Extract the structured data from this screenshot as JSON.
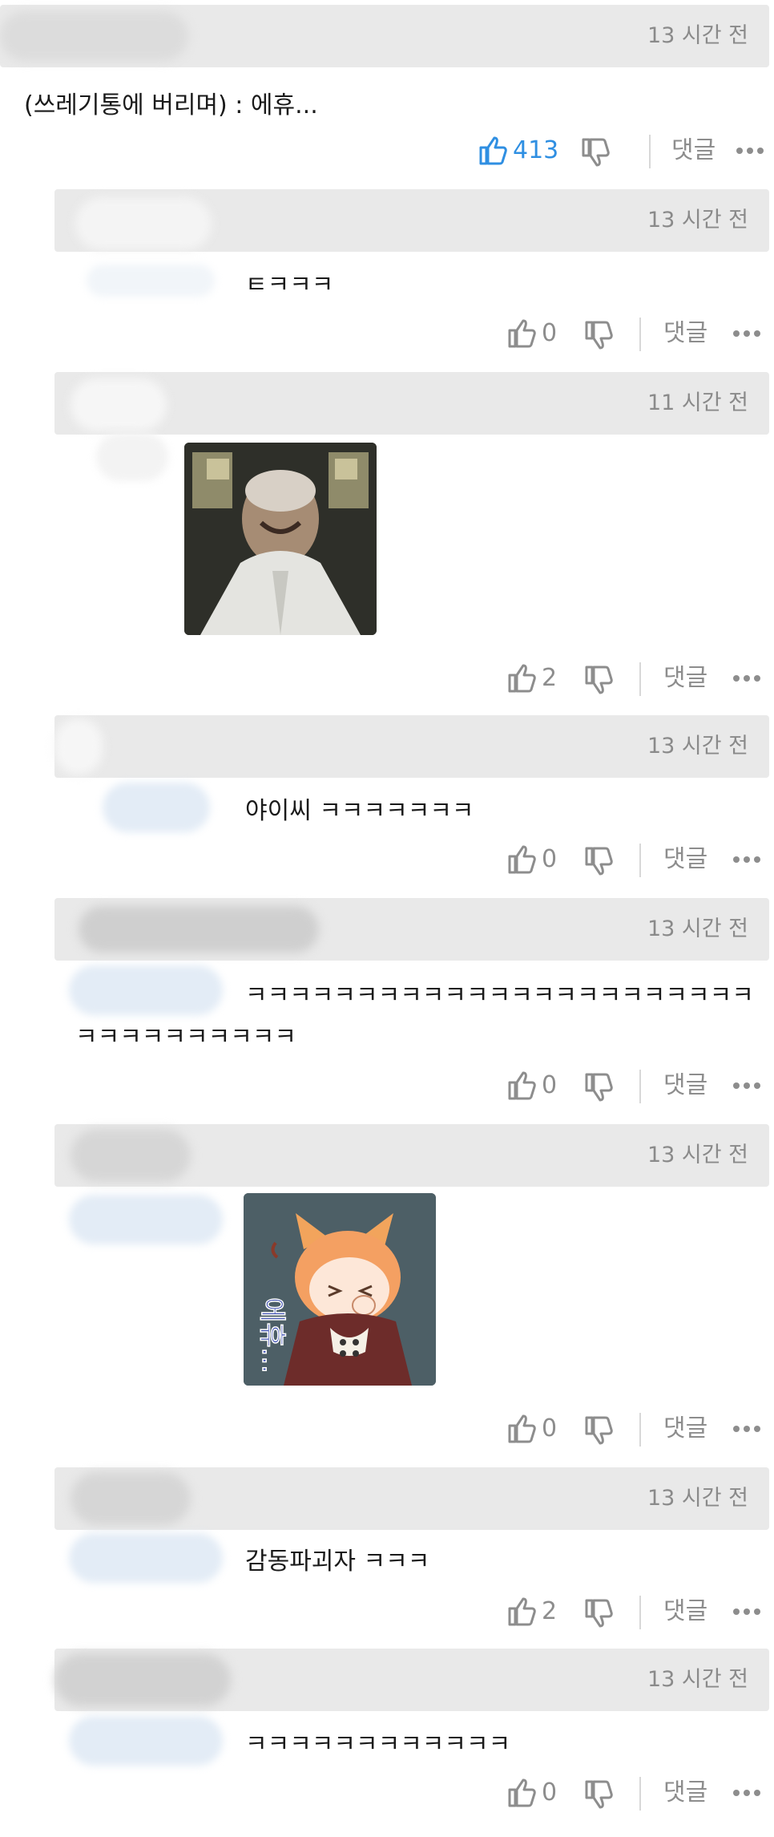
{
  "comments": [
    {
      "time": "13 시간 전",
      "text": "(쓰레기통에 버리며) : 에휴...",
      "likes": "413",
      "reply": "댓글"
    },
    {
      "time": "13 시간 전",
      "text": "ㅌㅋㅋㅋ",
      "likes": "0",
      "reply": "댓글"
    },
    {
      "time": "11 시간 전",
      "text": "",
      "likes": "2",
      "reply": "댓글"
    },
    {
      "time": "13 시간 전",
      "text": "야이씨 ㅋㅋㅋㅋㅋㅋㅋ",
      "likes": "0",
      "reply": "댓글"
    },
    {
      "time": "13 시간 전",
      "text_line1": "ㅋㅋㅋㅋㅋㅋㅋㅋㅋㅋㅋㅋㅋㅋㅋㅋㅋㅋㅋㅋㅋㅋㅋ",
      "text_line2": "ㅋㅋㅋㅋㅋㅋㅋㅋㅋㅋ",
      "likes": "0",
      "reply": "댓글"
    },
    {
      "time": "13 시간 전",
      "sticker_text": "에휴...",
      "likes": "0",
      "reply": "댓글"
    },
    {
      "time": "13 시간 전",
      "text": "감동파괴자 ㅋㅋㅋ",
      "likes": "2",
      "reply": "댓글"
    },
    {
      "time": "13 시간 전",
      "text": "ㅋㅋㅋㅋㅋㅋㅋㅋㅋㅋㅋㅋ",
      "likes": "0",
      "reply": "댓글"
    }
  ],
  "colors": {
    "header_bg": "#e9e9e9",
    "like_active": "#2f8fe2",
    "meta_gray": "#8d8d8d"
  },
  "icons": [
    "thumbs-up-icon",
    "thumbs-down-icon",
    "more-icon"
  ]
}
